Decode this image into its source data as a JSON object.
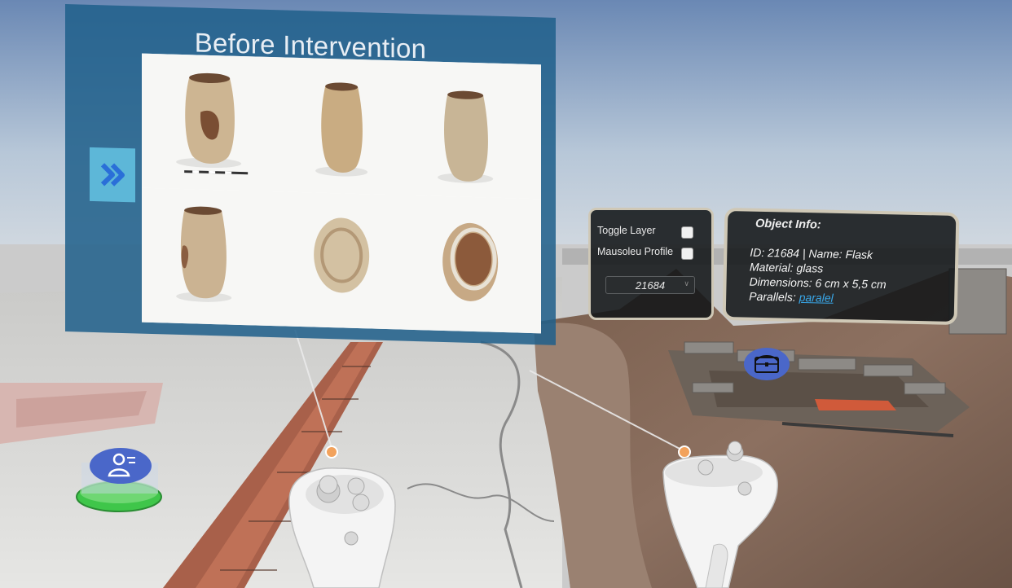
{
  "gallery": {
    "title": "Before Intervention",
    "next_icon": "double-chevron-right-icon",
    "photos": [
      {
        "view": "front-damaged"
      },
      {
        "view": "side"
      },
      {
        "view": "back"
      },
      {
        "view": "side-damaged"
      },
      {
        "view": "bottom"
      },
      {
        "view": "top-opening"
      }
    ]
  },
  "controls": {
    "toggle_layer_label": "Toggle Layer",
    "toggle_layer_checked": false,
    "mausoleu_profile_label": "Mausoleu Profile",
    "mausoleu_profile_checked": false,
    "object_select_value": "21684"
  },
  "object_info": {
    "title": "Object Info:",
    "id_name": "ID: 21684 | Name: Flask",
    "material": "Material: glass",
    "dimensions": "Dimensions: 6 cm x 5,5 cm",
    "parallels_label": "Parallels:",
    "parallels_link": "paralel"
  },
  "markers": {
    "teleport_icon": "person-teleport-icon",
    "artifact_icon": "chest-icon"
  },
  "colors": {
    "panel_blue": "#20608a",
    "next_button": "#5db7d8",
    "teleport_pad": "#3fc64a",
    "marker_blue": "#4a67c9",
    "link": "#39a7e8"
  }
}
